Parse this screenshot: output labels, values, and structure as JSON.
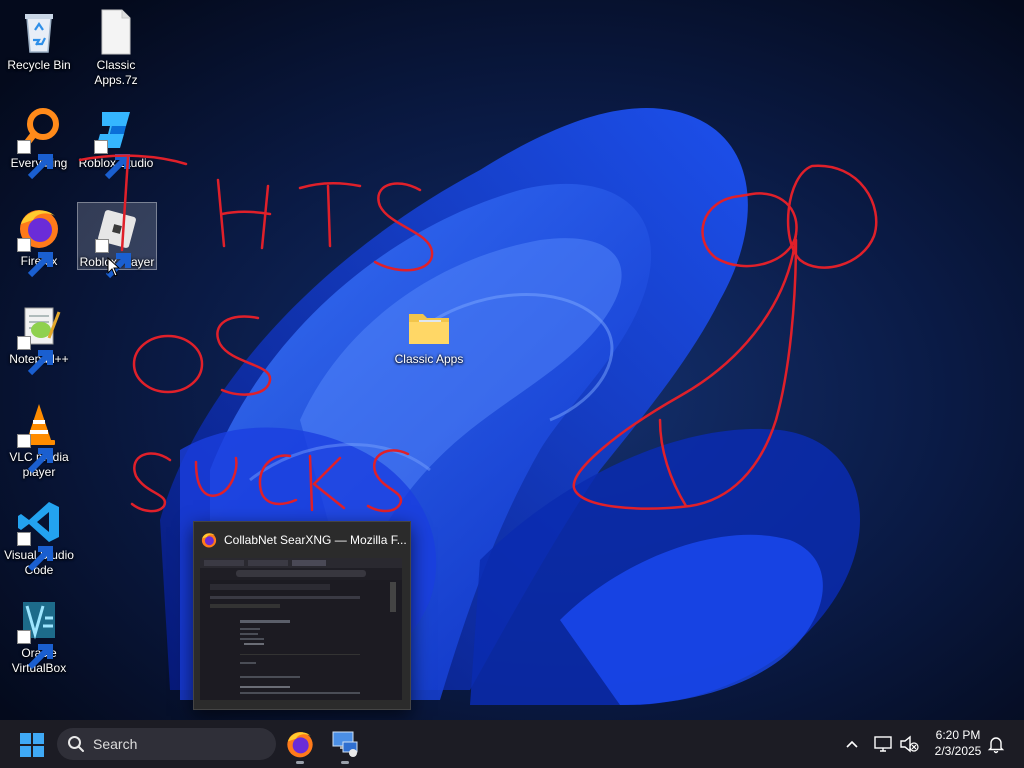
{
  "desktop": {
    "icons": {
      "recycle_bin": "Recycle Bin",
      "classic_apps_7z": "Classic Apps.7z",
      "everything": "Everything",
      "roblox_studio": "Roblox Studio",
      "firefox": "Firefox",
      "roblox_player": "Roblox Player",
      "notepadpp": "Notepad++",
      "vlc": "VLC media player",
      "vscode": "Visual Studio Code",
      "virtualbox": "Oracle VirtualBox",
      "classic_apps_folder": "Classic Apps"
    },
    "scribble_words": [
      "THIS",
      "OS",
      "SUCKS"
    ]
  },
  "preview": {
    "title": "CollabNet SearXNG — Mozilla F..."
  },
  "taskbar": {
    "search_placeholder": "Search",
    "time": "6:20 PM",
    "date": "2/3/2025"
  },
  "colors": {
    "taskbar_bg": "#1c1c24",
    "scribble": "#e0202a",
    "wallpaper_accent": "#1f56ff"
  },
  "icons": [
    "start-icon",
    "search-icon",
    "firefox-icon",
    "remote-desktop-icon",
    "chevron-up-icon",
    "network-icon",
    "volume-muted-icon",
    "notification-bell-icon"
  ]
}
